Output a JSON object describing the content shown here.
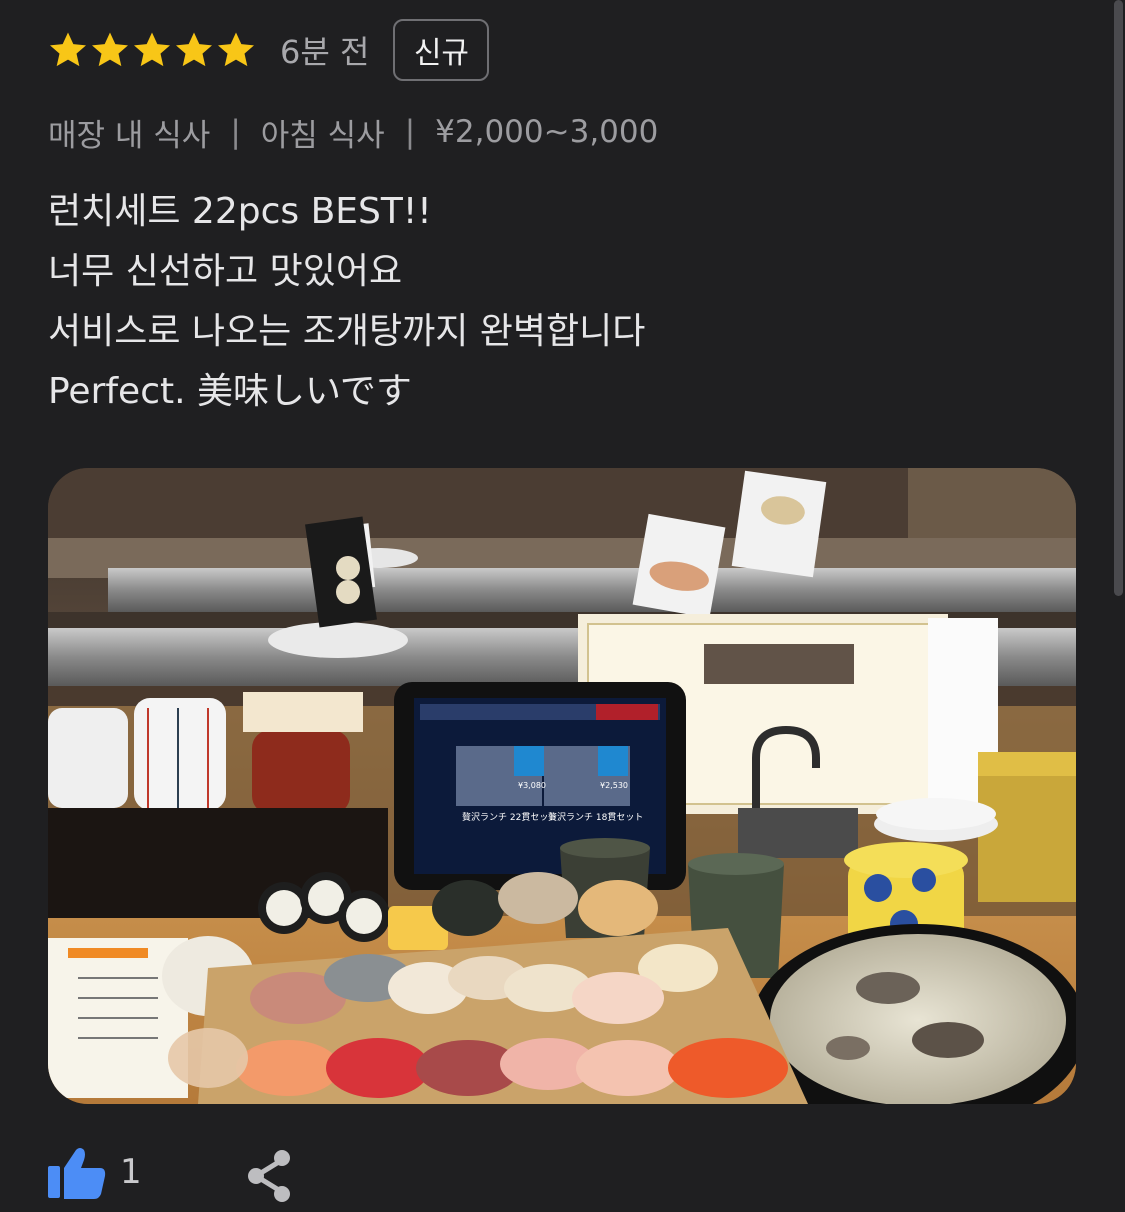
{
  "review": {
    "rating": 5,
    "max_rating": 5,
    "star_color": "#f8c617",
    "time_ago": "6분 전",
    "badge": "신규",
    "meta": [
      "매장 내 식사",
      "아침 식사",
      "¥2,000~3,000"
    ],
    "meta_separator": "|",
    "text_lines": [
      "런치세트 22pcs BEST!!",
      "너무 신선하고 맛있어요",
      "서비스로 나오는 조개탕까지 완벽합니다",
      "Perfect. 美味しいです"
    ],
    "photo": {
      "description_icon": "food-photo",
      "tablet_text": {
        "item_1": "贅沢ランチ 22貫セット",
        "item_1_price": "¥3,080",
        "item_2": "贅沢ランチ 18貫セット",
        "item_2_price": "¥2,530"
      }
    }
  },
  "actions": {
    "like_icon": "thumbs-up-icon",
    "like_count": "1",
    "share_icon": "share-icon",
    "accent": "#4c8df6"
  }
}
